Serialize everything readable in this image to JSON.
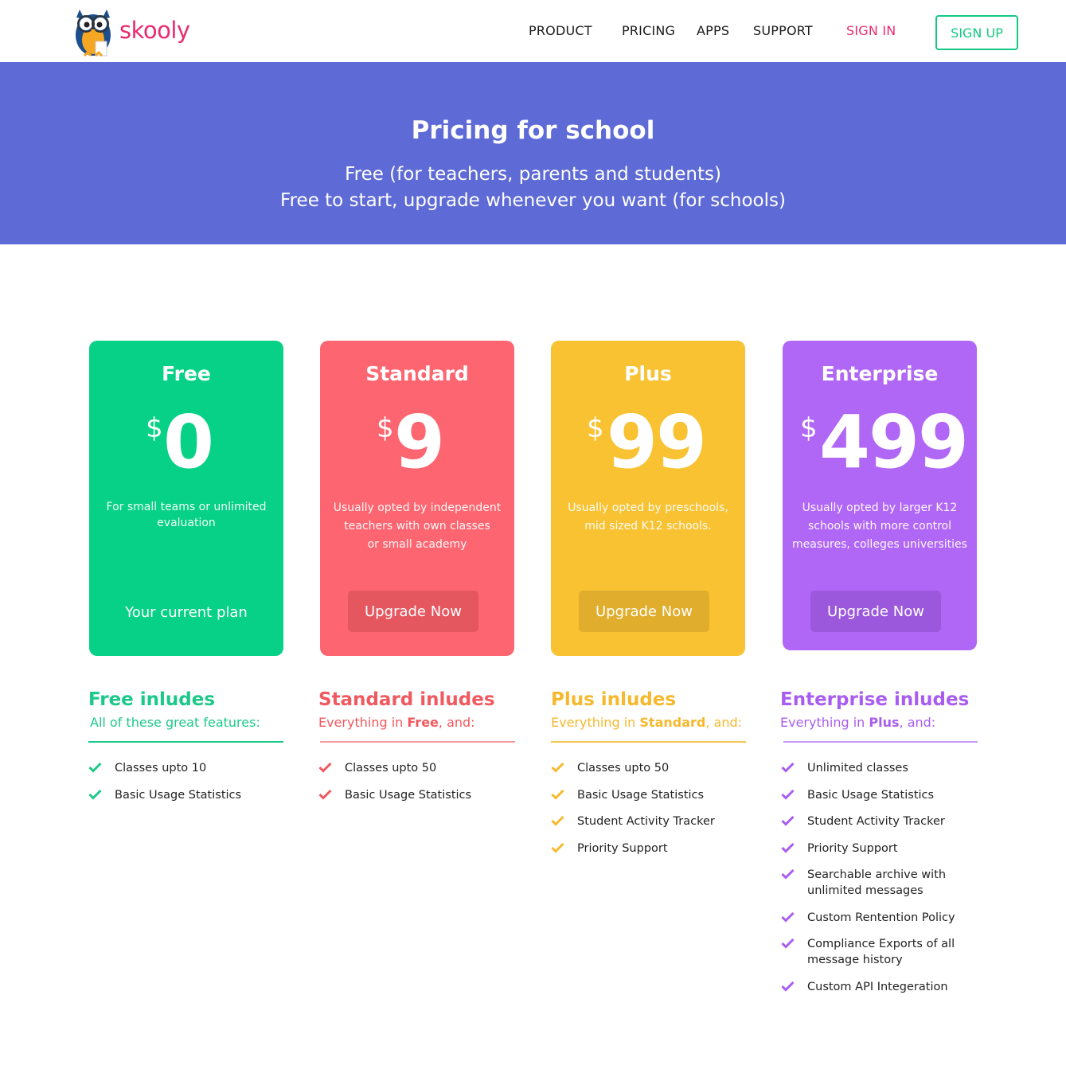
{
  "header": {
    "brand": "skooly",
    "nav": [
      "PRODUCT",
      "PRICING",
      "APPS",
      "SUPPORT"
    ],
    "sign_in": "SIGN IN",
    "sign_up": "SIGN UP"
  },
  "hero": {
    "title": "Pricing for school",
    "line1": "Free (for teachers, parents and students)",
    "line2": "Free to start, upgrade whenever you want (for schools)"
  },
  "plans": [
    {
      "name": "Free",
      "currency": "$",
      "price": "0",
      "desc": [
        "For small teams or unlimited",
        "evaluation"
      ],
      "status": "Your current plan",
      "color": "#06d186"
    },
    {
      "name": "Standard",
      "currency": "$",
      "price": "9",
      "desc": [
        "Usually opted by independent",
        "teachers with own classes",
        "or small academy"
      ],
      "action": "Upgrade Now",
      "color": "#fd6570"
    },
    {
      "name": "Plus",
      "currency": "$",
      "price": "99",
      "desc": [
        "Usually opted by preschools,",
        "mid sized K12 schools."
      ],
      "action": "Upgrade Now",
      "color": "#f8c232"
    },
    {
      "name": "Enterprise",
      "currency": "$",
      "price": "499",
      "desc": [
        "Usually opted by larger K12",
        "schools with more control",
        "measures, colleges universities"
      ],
      "action": "Upgrade Now",
      "color": "#b167f6"
    }
  ],
  "includes": [
    {
      "title": "Free inludes",
      "sub_prefix": "All of these great features:",
      "sub_bold": "",
      "sub_suffix": "",
      "color": "#1dc989",
      "features": [
        "Classes upto 10",
        "Basic Usage Statistics"
      ]
    },
    {
      "title": "Standard inludes",
      "sub_prefix": "Everything in ",
      "sub_bold": "Free",
      "sub_suffix": ", and:",
      "color": "#f0595f",
      "features": [
        "Classes upto 50",
        "Basic Usage Statistics"
      ]
    },
    {
      "title": "Plus inludes",
      "sub_prefix": "Everything in ",
      "sub_bold": "Standard",
      "sub_suffix": ", and:",
      "color": "#f6b92d",
      "features": [
        "Classes upto 50",
        "Basic Usage Statistics",
        "Student Activity Tracker",
        "Priority Support"
      ]
    },
    {
      "title": "Enterprise inludes",
      "sub_prefix": "Everything in ",
      "sub_bold": "Plus",
      "sub_suffix": ", and:",
      "color": "#a95df0",
      "features": [
        [
          "Unlimited classes"
        ],
        [
          "Basic Usage Statistics"
        ],
        [
          "Student Activity Tracker"
        ],
        [
          "Priority Support"
        ],
        [
          "Searchable archive with",
          "unlimited messages"
        ],
        [
          "Custom Rentention Policy"
        ],
        [
          "Compliance Exports of all",
          "message history"
        ],
        [
          "Custom API Integeration"
        ]
      ]
    }
  ]
}
